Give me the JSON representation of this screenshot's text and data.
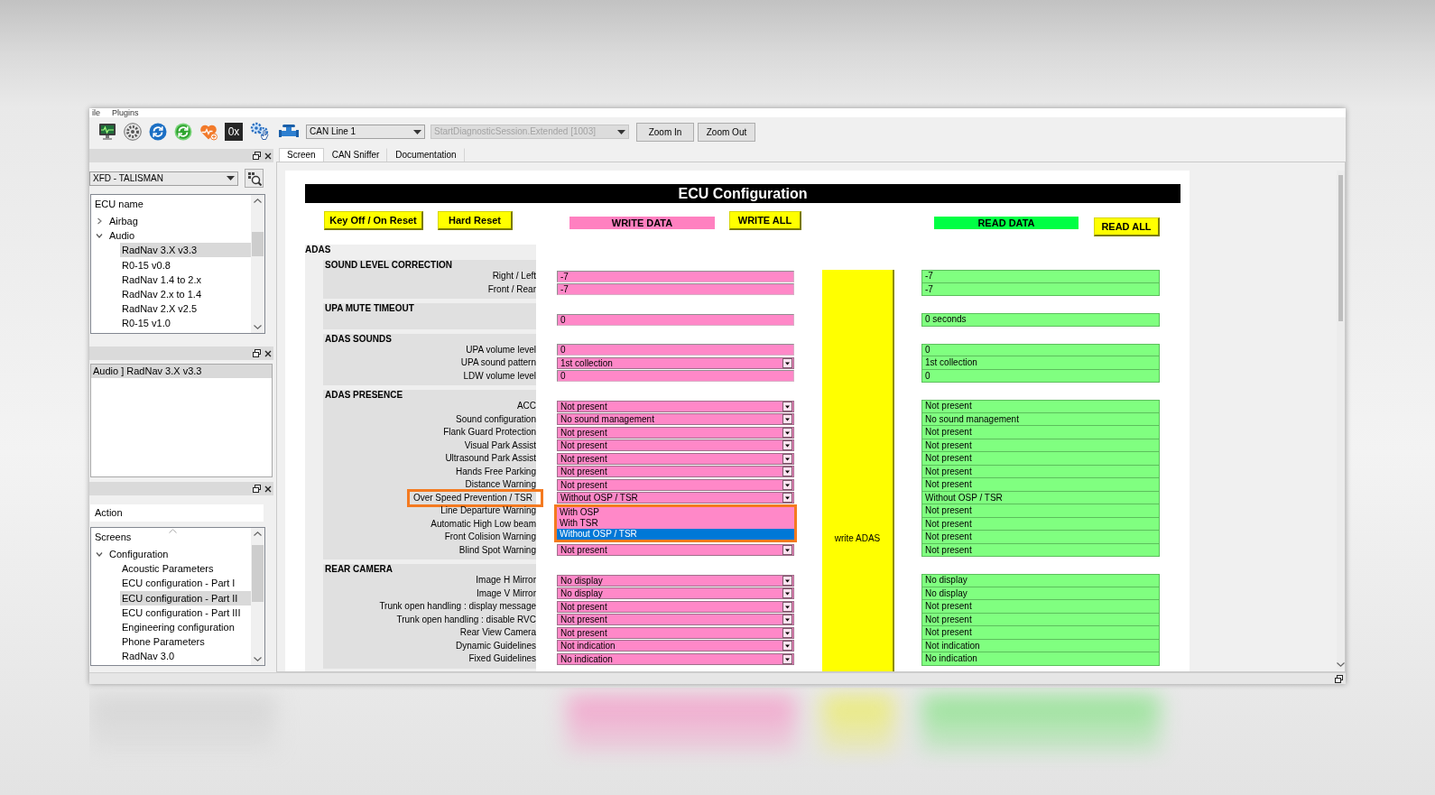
{
  "menu": [
    "ile",
    "Plugins"
  ],
  "toolbar": {
    "hex_label": "0x",
    "dropdowns": [
      {
        "value": "CAN Line 1",
        "disabled": false
      },
      {
        "value": "StartDiagnosticSession.Extended [1003]",
        "disabled": true
      }
    ],
    "buttons": [
      "Zoom In",
      "Zoom Out"
    ]
  },
  "ecu_panel": {
    "model": "XFD - TALISMAN",
    "tree": {
      "header": "ECU name",
      "items": [
        {
          "label": "Airbag",
          "expanded": false,
          "selected": false
        },
        {
          "label": "Audio",
          "expanded": true,
          "selected": false,
          "children": [
            {
              "label": "RadNav 3.X v3.3",
              "selected": true
            },
            {
              "label": "R0-15 v0.8",
              "selected": false
            },
            {
              "label": "RadNav 1.4 to 2.x",
              "selected": false
            },
            {
              "label": "RadNav 2.x to 1.4",
              "selected": false
            },
            {
              "label": "RadNav 2.X v2.5",
              "selected": false
            },
            {
              "label": "R0-15 v1.0",
              "selected": false
            }
          ]
        }
      ]
    }
  },
  "path_panel": {
    "items": [
      {
        "label": "Audio ] RadNav 3.X v3.3",
        "selected": true
      }
    ]
  },
  "screens_panel": {
    "action": "Action",
    "tree": {
      "header": "Screens",
      "items": [
        {
          "label": "Configuration",
          "expanded": true,
          "selected": false,
          "children": [
            {
              "label": "Acoustic Parameters",
              "selected": false
            },
            {
              "label": "ECU configuration - Part I",
              "selected": false
            },
            {
              "label": "ECU configuration - Part II",
              "selected": true
            },
            {
              "label": "ECU configuration - Part III",
              "selected": false
            },
            {
              "label": "Engineering configuration",
              "selected": false
            },
            {
              "label": "Phone Parameters",
              "selected": false
            },
            {
              "label": "RadNav 3.0",
              "selected": false
            }
          ]
        }
      ]
    }
  },
  "tabs": [
    {
      "label": "Screen",
      "selected": true
    },
    {
      "label": "CAN Sniffer",
      "selected": false
    },
    {
      "label": "Documentation",
      "selected": false
    }
  ],
  "screen": {
    "title": "ECU Configuration",
    "reset_buttons": [
      "Key Off / On Reset",
      "Hard Reset"
    ],
    "write_header": "WRITE DATA",
    "write_all": "WRITE ALL",
    "read_header": "READ DATA",
    "read_all": "READ ALL",
    "group": "ADAS",
    "write_group_button": "write ADAS",
    "sections": [
      {
        "title": "SOUND LEVEL CORRECTION",
        "rows": [
          {
            "label": "Right / Left",
            "kind": "text",
            "highlighted": false,
            "write": "-7",
            "read": "-7"
          },
          {
            "label": "Front / Rear",
            "kind": "text",
            "highlighted": false,
            "write": "-7",
            "read": "-7"
          }
        ]
      },
      {
        "title": "UPA MUTE TIMEOUT",
        "rows": [
          {
            "kind": "text",
            "highlighted": false,
            "write": "0",
            "read": "0 seconds"
          }
        ]
      },
      {
        "title": "ADAS SOUNDS",
        "rows": [
          {
            "label": "UPA volume level",
            "kind": "text",
            "highlighted": false,
            "write": "0",
            "read": "0"
          },
          {
            "label": "UPA sound pattern",
            "kind": "dropdown",
            "highlighted": false,
            "write": "1st collection",
            "read": "1st collection"
          },
          {
            "label": "LDW volume level",
            "kind": "text",
            "highlighted": false,
            "write": "0",
            "read": "0"
          }
        ]
      },
      {
        "title": "ADAS PRESENCE",
        "rows": [
          {
            "label": "ACC",
            "kind": "dropdown",
            "highlighted": false,
            "write": "Not present",
            "read": "Not present"
          },
          {
            "label": "Sound configuration",
            "kind": "dropdown",
            "highlighted": false,
            "write": "No sound management",
            "read": "No sound management"
          },
          {
            "label": "Flank Guard Protection",
            "kind": "dropdown",
            "highlighted": false,
            "write": "Not present",
            "read": "Not present"
          },
          {
            "label": "Visual Park Assist",
            "kind": "dropdown",
            "highlighted": false,
            "write": "Not present",
            "read": "Not present"
          },
          {
            "label": "Ultrasound Park Assist",
            "kind": "dropdown",
            "highlighted": false,
            "write": "Not present",
            "read": "Not present"
          },
          {
            "label": "Hands Free Parking",
            "kind": "dropdown",
            "highlighted": false,
            "write": "Not present",
            "read": "Not present"
          },
          {
            "label": "Distance Warning",
            "kind": "dropdown",
            "highlighted": false,
            "write": "Not present",
            "read": "Not present"
          },
          {
            "label": "Over Speed Prevention / TSR",
            "kind": "dropdown",
            "highlighted": true,
            "write": "Without OSP / TSR",
            "read": "Without OSP / TSR",
            "options": [
              {
                "label": "With OSP",
                "selected": false
              },
              {
                "label": "With TSR",
                "selected": false
              },
              {
                "label": "Without OSP / TSR",
                "selected": true
              }
            ]
          },
          {
            "label": "Line Departure Warning",
            "highlighted": false,
            "read": "Not present"
          },
          {
            "label": "Automatic High Low beam",
            "highlighted": false,
            "read": "Not present"
          },
          {
            "label": "Front Colision Warning",
            "highlighted": false,
            "read": "Not present"
          },
          {
            "label": "Blind Spot Warning",
            "kind": "dropdown",
            "highlighted": false,
            "write": "Not present",
            "read": "Not present"
          }
        ]
      },
      {
        "title": "REAR CAMERA",
        "rows": [
          {
            "label": "Image H Mirror",
            "kind": "dropdown",
            "highlighted": false,
            "write": "No display",
            "read": "No display"
          },
          {
            "label": "Image V Mirror",
            "kind": "dropdown",
            "highlighted": false,
            "write": "No display",
            "read": "No display"
          },
          {
            "label": "Trunk open handling : display message",
            "kind": "dropdown",
            "highlighted": false,
            "write": "Not present",
            "read": "Not present"
          },
          {
            "label": "Trunk open handling : disable RVC",
            "kind": "dropdown",
            "highlighted": false,
            "write": "Not present",
            "read": "Not present"
          },
          {
            "label": "Rear View Camera",
            "kind": "dropdown",
            "highlighted": false,
            "write": "Not present",
            "read": "Not present"
          },
          {
            "label": "Dynamic Guidelines",
            "kind": "dropdown",
            "highlighted": false,
            "write": "Not indication",
            "read": "Not indication"
          },
          {
            "label": "Fixed Guidelines",
            "kind": "dropdown",
            "highlighted": false,
            "write": "No indication",
            "read": "No indication"
          }
        ]
      }
    ]
  }
}
